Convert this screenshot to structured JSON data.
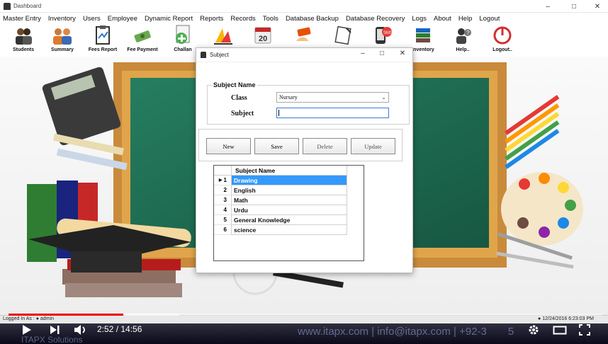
{
  "window": {
    "title": "Dashboard"
  },
  "menu": [
    "Master Entry",
    "Inventory",
    "Users",
    "Employee",
    "Dynamic Report",
    "Reports",
    "Records",
    "Tools",
    "Database Backup",
    "Database Recovery",
    "Logs",
    "About",
    "Help",
    "Logout"
  ],
  "toolbar": {
    "students": "Students",
    "summary": "Summary",
    "fees_report": "Fees Report",
    "fee_payment": "Fee Payment",
    "challan": "Challan",
    "inventory": "Inventory",
    "help": "Help..",
    "logout": "Logout.."
  },
  "dialog": {
    "title": "Subject",
    "group_title": "Subject Name",
    "class_label": "Class",
    "class_value": "Nursary",
    "subject_label": "Subject",
    "subject_value": "",
    "buttons": {
      "new": "New",
      "save": "Save",
      "delete": "Delete",
      "update": "Update"
    },
    "grid": {
      "column": "Subject Name",
      "rows": [
        {
          "num": "1",
          "name": "Drawing",
          "selected": true
        },
        {
          "num": "2",
          "name": "English"
        },
        {
          "num": "3",
          "name": "Math"
        },
        {
          "num": "4",
          "name": "Urdu"
        },
        {
          "num": "5",
          "name": "General Knowledge"
        },
        {
          "num": "6",
          "name": "science"
        }
      ]
    }
  },
  "status": {
    "logged_in_prefix": "Logged In As :",
    "user": "admin",
    "datetime": "12/24/2016 6:23:03 PM"
  },
  "player": {
    "time": "2:52 / 14:56",
    "progress_fraction": 0.193,
    "watermark": "www.itapx.com | info@itapx.com | +92-3",
    "watermark_tail": "5",
    "brand": "ITAPX Solutions"
  },
  "colors": {
    "accent_red": "#e00000",
    "selection": "#3399ff",
    "chalkboard": "#1e7a5a"
  }
}
